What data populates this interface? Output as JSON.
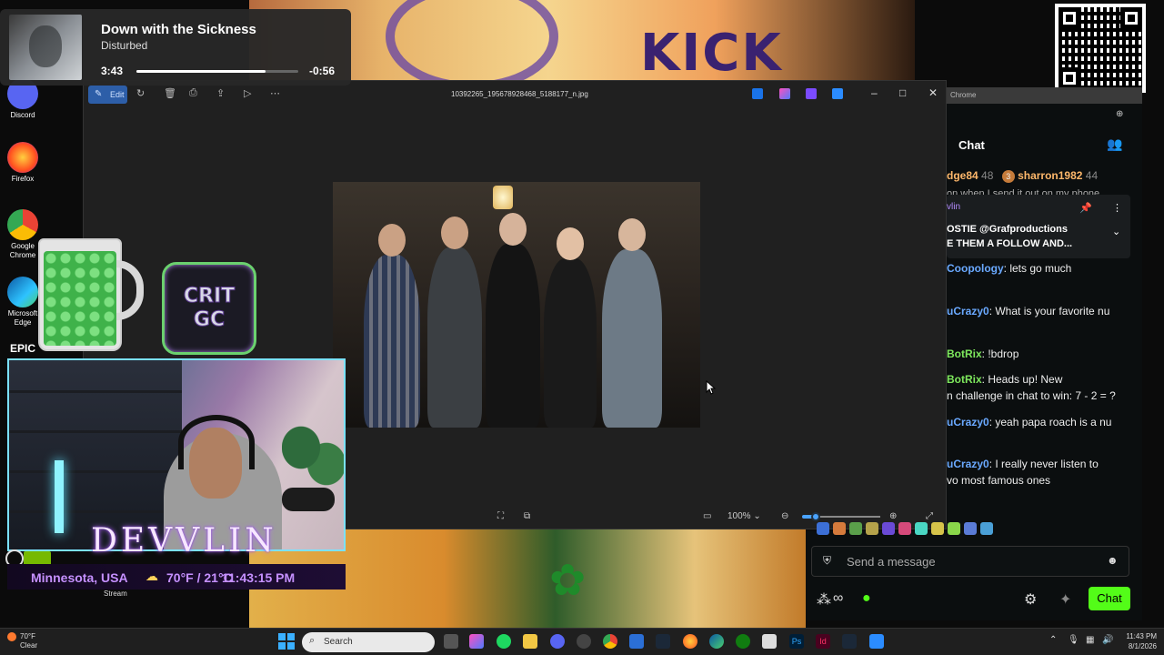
{
  "now_playing": {
    "title": "Down with the Sickness",
    "artist": "Disturbed",
    "elapsed": "3:43",
    "remaining": "-0:56",
    "progress": 0.8
  },
  "desktop_icons": [
    {
      "label": "Discord"
    },
    {
      "label": "Firefox"
    },
    {
      "label": "Google Chrome"
    },
    {
      "label": "Microsoft Edge"
    },
    {
      "label": "EPIC"
    }
  ],
  "photos": {
    "edit_label": "Edit",
    "filename": "10392265_195678928468_5188177_n.jpg",
    "zoom": "100%"
  },
  "overlay": {
    "brand": "KICK",
    "crit_line1": "CRIT",
    "crit_line2": "GC",
    "streamer_name": "DEVVLIN",
    "location": "Minnesota, USA",
    "temperature": "70°F / 21°C",
    "time": "11:43:15 PM",
    "stream_label": "Stream"
  },
  "chrome": {
    "tab_label": "Chrome"
  },
  "chat": {
    "title": "Chat",
    "top_users": [
      {
        "name": "dge84",
        "count": "48"
      },
      {
        "name": "sharron1982",
        "count": "44",
        "rank": "3"
      }
    ],
    "truncated_line": "on when I send it out on my phone",
    "pinned": {
      "author": "vlin",
      "text_line1": "OSTIE @Grafproductions",
      "text_line2": "E THEM A FOLLOW AND..."
    },
    "messages": [
      {
        "user": "Coopology",
        "text": ": lets go much",
        "color": "#6aa9ff"
      },
      {
        "user": "uCrazy0",
        "text": ": What is your favorite nu",
        "color": "#6aa9ff"
      },
      {
        "user": "BotRix",
        "text": ": !bdrop",
        "color": "#7ee85d"
      },
      {
        "user": "BotRix",
        "text": ":       Heads up! New",
        "color": "#7ee85d"
      },
      {
        "user": "",
        "text": "n challenge in chat to win: 7 - 2 = ?",
        "color": "#eeeeee"
      },
      {
        "user": "uCrazy0",
        "text": ": yeah papa roach is a nu",
        "color": "#6aa9ff"
      },
      {
        "user": "uCrazy0",
        "text": ": I really never listen to",
        "color": "#6aa9ff"
      },
      {
        "user": "",
        "text": "vo most famous ones",
        "color": "#eeeeee"
      }
    ],
    "input_placeholder": "Send a message",
    "send_label": "Chat",
    "accent": "#53fc18"
  },
  "taskbar": {
    "weather_temp": "70°F",
    "weather_desc": "Clear",
    "search_placeholder": "Search",
    "clock_time": "11:43 PM",
    "clock_date": "8/1/2026"
  }
}
